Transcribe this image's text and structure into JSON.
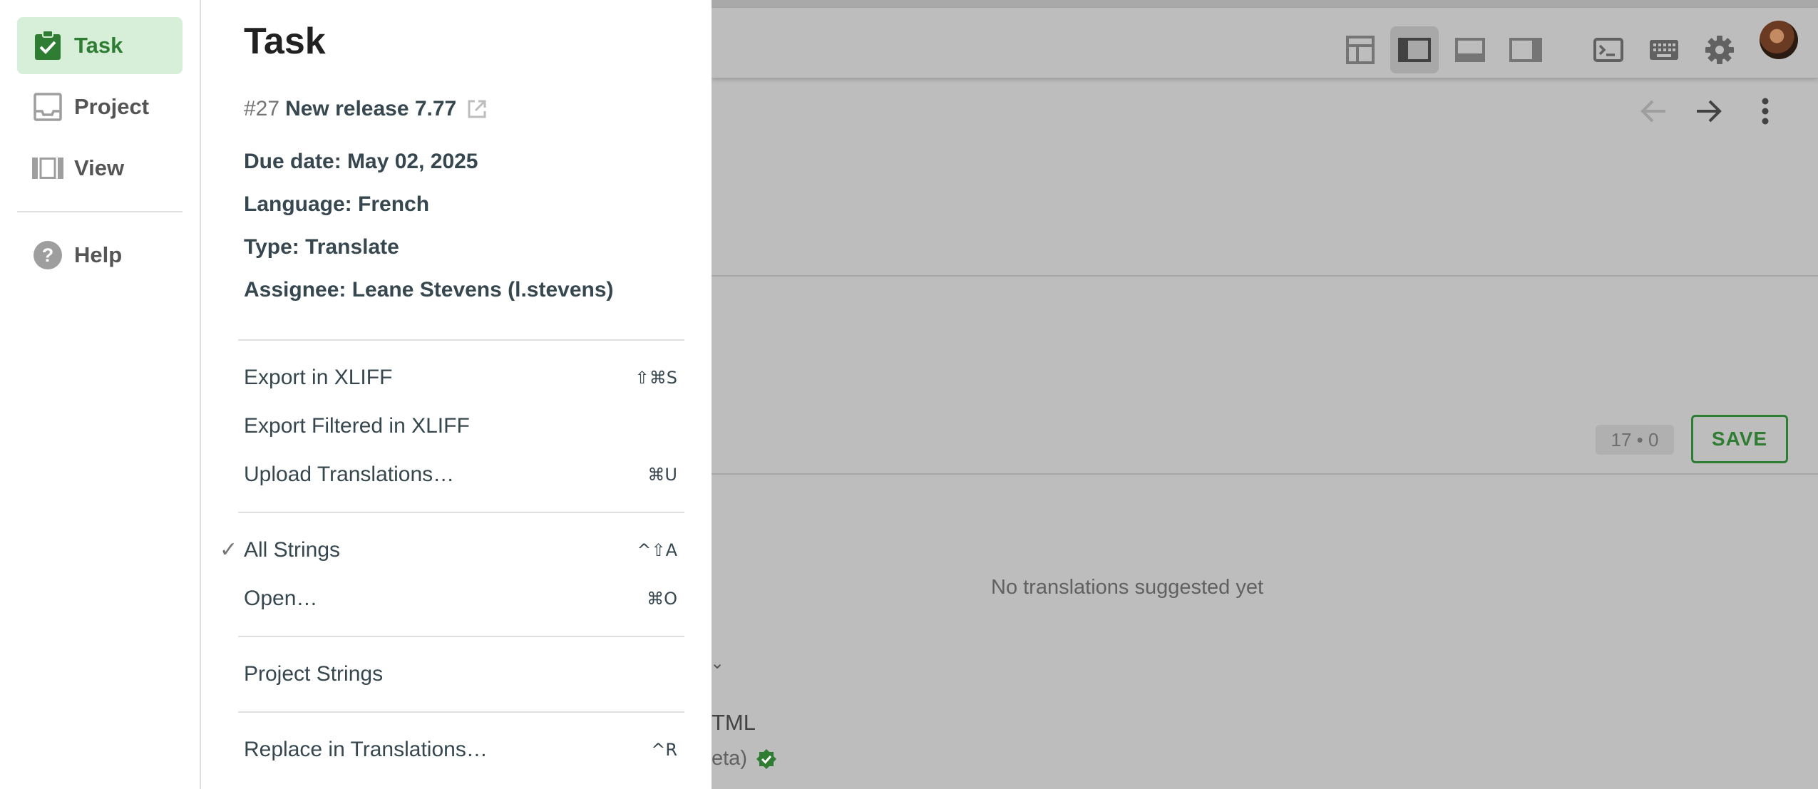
{
  "rail": {
    "items": [
      {
        "label": "Task",
        "icon": "clipboard-check-icon",
        "active": true
      },
      {
        "label": "Project",
        "icon": "inbox-icon",
        "active": false
      },
      {
        "label": "View",
        "icon": "columns-icon",
        "active": false
      },
      {
        "label": "Help",
        "icon": "help-circle-icon",
        "active": false
      }
    ]
  },
  "menu": {
    "title": "Task",
    "task_id": "#27",
    "task_name": "New release 7.77",
    "due_date": "Due date: May 02, 2025",
    "language": "Language: French",
    "type": "Type: Translate",
    "assignee": "Assignee: Leane Stevens (l.stevens)",
    "items": [
      {
        "label": "Export in XLIFF",
        "shortcut": "⇧⌘S"
      },
      {
        "label": "Export Filtered in XLIFF",
        "shortcut": ""
      },
      {
        "label": "Upload Translations…",
        "shortcut": "⌘U"
      },
      {
        "label": "All Strings",
        "shortcut": "^⇧A",
        "checked": true
      },
      {
        "label": "Open…",
        "shortcut": "⌘O"
      },
      {
        "label": "Project Strings",
        "shortcut": ""
      },
      {
        "label": "Replace in Translations…",
        "shortcut": "^R"
      }
    ]
  },
  "background": {
    "count_chip": "17 • 0",
    "save_label": "SAVE",
    "empty_message": "No translations suggested yet",
    "fragment_1": "TML",
    "fragment_2": "eta)",
    "fragment_3": "⌄"
  },
  "colors": {
    "accent": "#2e7d32",
    "active_bg": "#d7efd9",
    "overlay": "#bdbdbd"
  }
}
